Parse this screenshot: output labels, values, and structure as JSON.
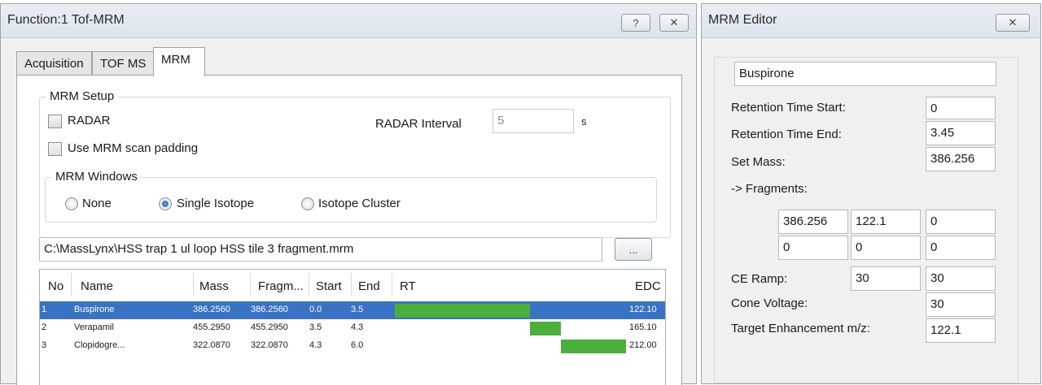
{
  "function_window": {
    "title": "Function:1 Tof-MRM",
    "help_label": "?",
    "close_label": "✕",
    "tabs": [
      {
        "label": "Acquisition"
      },
      {
        "label": "TOF MS"
      },
      {
        "label": "MRM"
      }
    ],
    "mrm_setup": {
      "label": "MRM Setup",
      "radar_label": "RADAR",
      "radar_checked": false,
      "radar_interval_label": "RADAR Interval",
      "radar_interval_value": "5",
      "radar_interval_unit": "s",
      "scan_padding_label": "Use MRM scan padding",
      "scan_padding_checked": false
    },
    "mrm_windows": {
      "label": "MRM Windows",
      "options": [
        {
          "label": "None",
          "selected": false
        },
        {
          "label": "Single Isotope",
          "selected": true
        },
        {
          "label": "Isotope Cluster",
          "selected": false
        }
      ]
    },
    "file_path": "C:\\MassLynx\\HSS trap 1 ul loop HSS tile 3 fragment.mrm",
    "browse_label": "...",
    "table": {
      "columns": [
        "No",
        "Name",
        "Mass",
        "Fragm...",
        "Start",
        "End",
        "RT",
        "EDC"
      ],
      "rt_range": [
        0,
        6.0
      ],
      "rows": [
        {
          "no": "1",
          "name": "Buspirone",
          "mass": "386.2560",
          "fragment": "386.2560",
          "start": "0.0",
          "end": "3.5",
          "rt_start": 0.0,
          "rt_end": 3.5,
          "edc": "122.10",
          "selected": true
        },
        {
          "no": "2",
          "name": "Verapamil",
          "mass": "455.2950",
          "fragment": "455.2950",
          "start": "3.5",
          "end": "4.3",
          "rt_start": 3.5,
          "rt_end": 4.3,
          "edc": "165.10",
          "selected": false
        },
        {
          "no": "3",
          "name": "Clopidogre...",
          "mass": "322.0870",
          "fragment": "322.0870",
          "start": "4.3",
          "end": "6.0",
          "rt_start": 4.3,
          "rt_end": 6.0,
          "edc": "212.00",
          "selected": false
        }
      ]
    }
  },
  "mrm_editor": {
    "title": "MRM Editor",
    "close_label": "✕",
    "compound_name": "Buspirone",
    "retention_start_label": "Retention Time Start:",
    "retention_start_value": "0",
    "retention_end_label": "Retention Time End:",
    "retention_end_value": "3.45",
    "set_mass_label": "Set Mass:",
    "set_mass_value": "386.256",
    "fragments_label": "-> Fragments:",
    "fragments": [
      [
        "386.256",
        "122.1",
        "0"
      ],
      [
        "0",
        "0",
        "0"
      ]
    ],
    "ce_ramp_label": "CE Ramp:",
    "ce_ramp_values": [
      "30",
      "30"
    ],
    "cone_voltage_label": "Cone Voltage:",
    "cone_voltage_value": "30",
    "target_enhancement_label": "Target Enhancement m/z:",
    "target_enhancement_value": "122.1"
  },
  "colors": {
    "selection": "#3a72c4",
    "rt_bar": "#4cae3c"
  }
}
